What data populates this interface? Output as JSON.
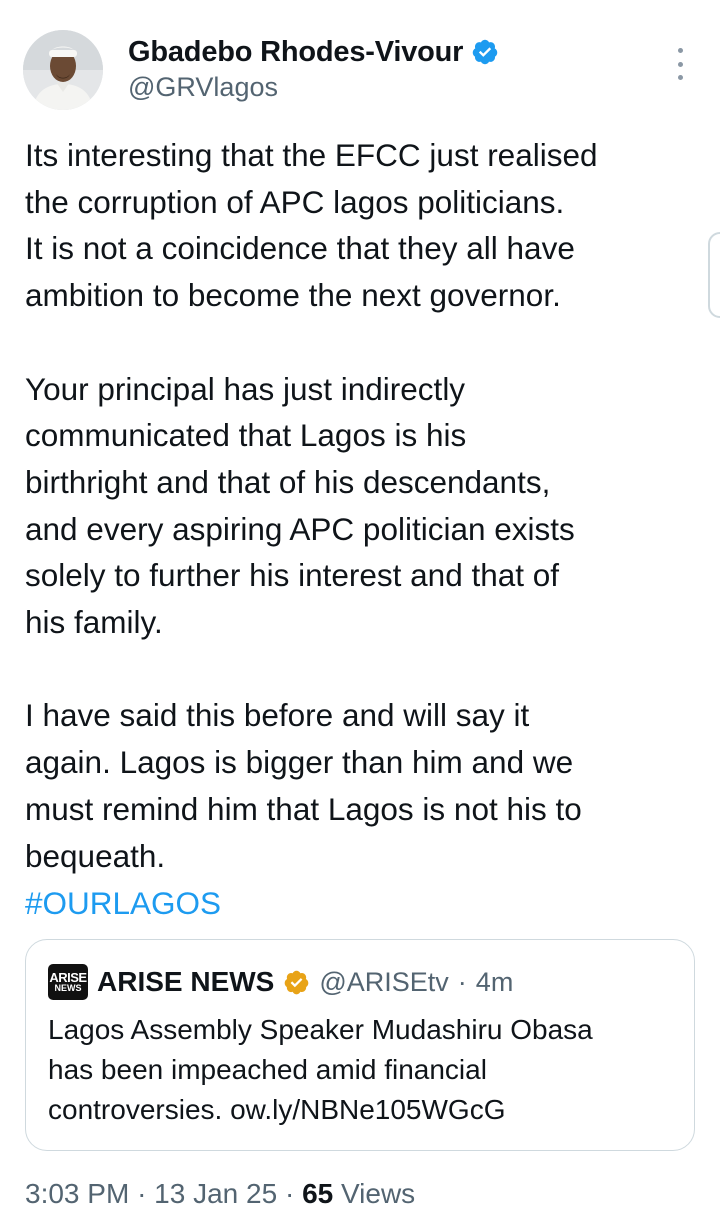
{
  "author": {
    "name": "Gbadebo Rhodes-Vivour",
    "handle": "@GRVlagos",
    "verified_color": "#1d9bf0",
    "avatar_icon": "profile-photo"
  },
  "tweet": {
    "text": "Its interesting that the EFCC just realised\nthe corruption of APC lagos politicians.\nIt is not a coincidence that they all have\nambition to become the next governor.\n\nYour principal has just indirectly\ncommunicated that Lagos is his\nbirthright and that of his descendants,\nand every aspiring APC politician exists\nsolely to further his interest and that of\nhis family.\n\nI have said this before and will say it\nagain. Lagos is bigger than him and we\nmust remind him that Lagos is not his to\nbequeath.",
    "hashtag": "#OURLAGOS",
    "hashtag_color": "#1d9bf0"
  },
  "quoted": {
    "logo_line1": "ARISE",
    "logo_line2": "NEWS",
    "name": "ARISE NEWS",
    "handle": "@ARISEtv",
    "separator": "·",
    "time": "4m",
    "badge_color": "#e8a317",
    "text": "Lagos Assembly Speaker Mudashiru Obasa\nhas been impeached amid financial\ncontroversies. ow.ly/NBNe105WGcG"
  },
  "meta": {
    "time": "3:03 PM",
    "sep1": "·",
    "date": "13 Jan 25",
    "sep2": "·",
    "views_count": "65",
    "views_label": "Views"
  }
}
